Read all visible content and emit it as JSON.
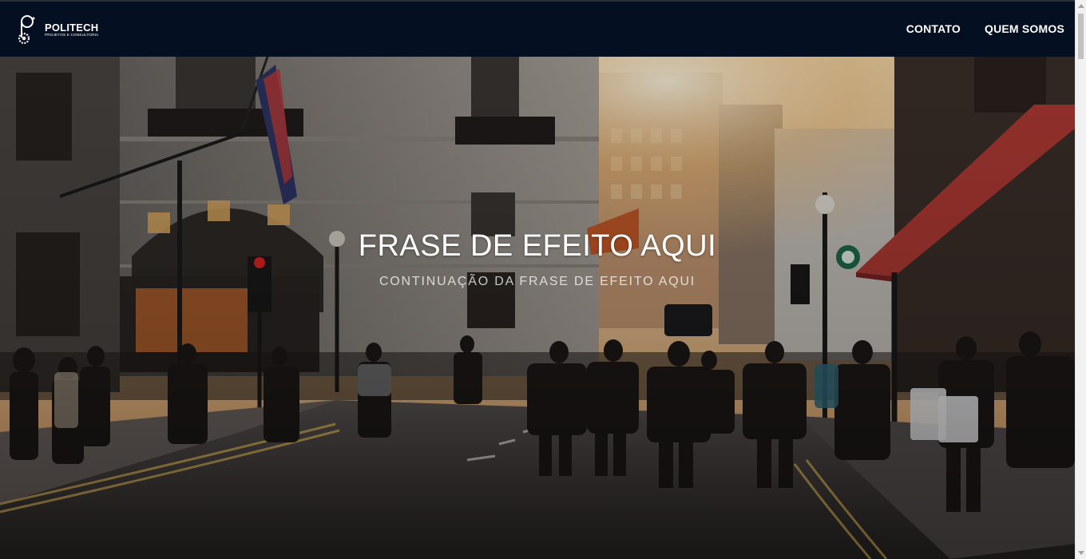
{
  "brand": {
    "name": "POLITECH",
    "tagline": "PROJETOS E CONSULTORIA",
    "logo_icon": "gear-p-logo-icon"
  },
  "nav": {
    "items": [
      {
        "label": "CONTATO"
      },
      {
        "label": "QUEM SOMOS"
      }
    ]
  },
  "hero": {
    "headline": "FRASE DE EFEITO AQUI",
    "subheadline": "CONTINUAÇÃO DA FRASE DE EFEITO AQUI",
    "background_description_icon": "city-street-photo"
  },
  "colors": {
    "navbar_bg": "#050f22",
    "nav_text": "#ffffff",
    "awning_red": "#b23a34"
  }
}
